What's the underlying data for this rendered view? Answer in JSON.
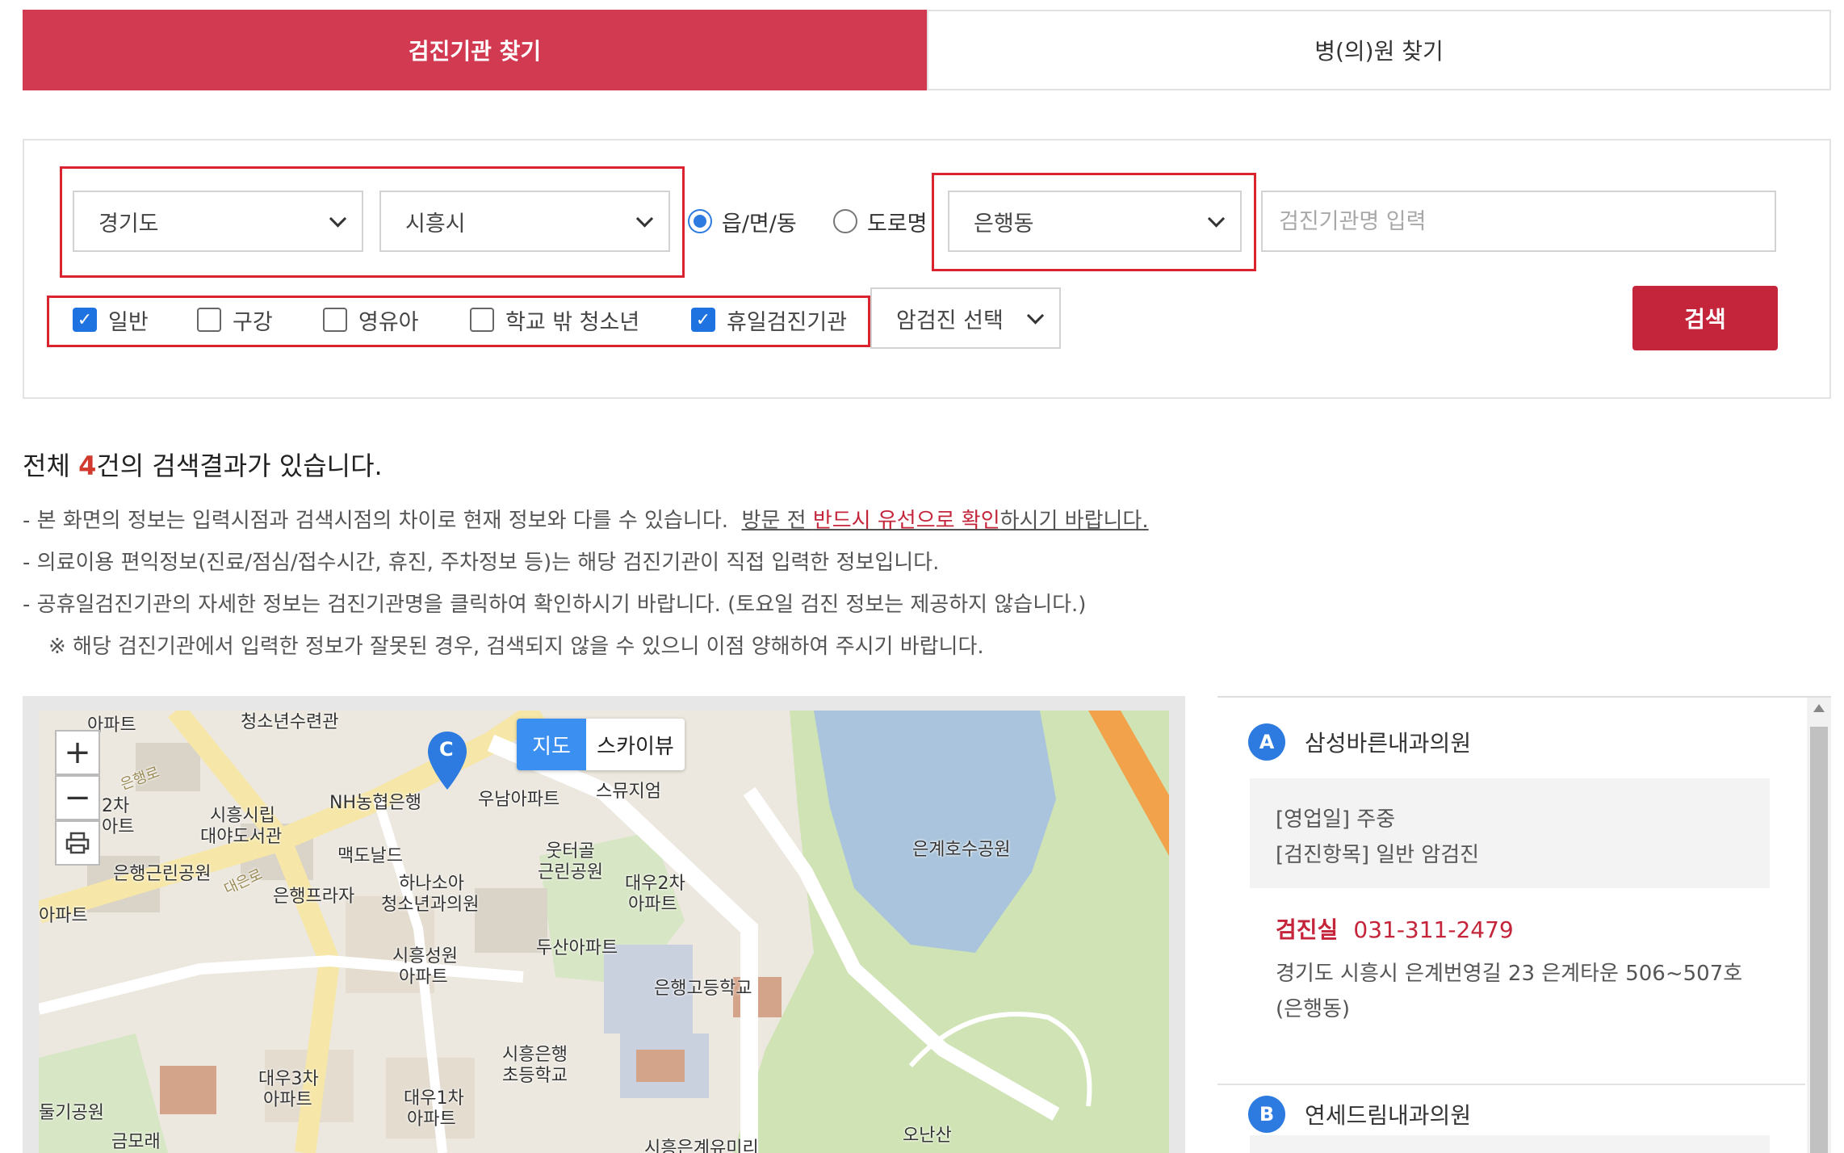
{
  "tabs": {
    "active": "검진기관 찾기",
    "inactive": "병(의)원 찾기"
  },
  "search": {
    "province": "경기도",
    "city": "시흥시",
    "radio_eup": "읍/면/동",
    "radio_road": "도로명",
    "dong": "은행동",
    "name_placeholder": "검진기관명 입력",
    "checkboxes": [
      {
        "label": "일반",
        "checked": true
      },
      {
        "label": "구강",
        "checked": false
      },
      {
        "label": "영유아",
        "checked": false
      },
      {
        "label": "학교 밖 청소년",
        "checked": false
      },
      {
        "label": "휴일검진기관",
        "checked": true
      }
    ],
    "cancer_select": "암검진 선택",
    "search_button": "검색"
  },
  "results": {
    "prefix": "전체 ",
    "count": "4",
    "suffix": "건의 검색결과가 있습니다.",
    "notes": {
      "n1_a": "- 본 화면의 정보는 입력시점과 검색시점의 차이로 현재 정보와 다를 수 있습니다.  ",
      "n1_b": "방문 전 ",
      "n1_c": "반드시 유선으로 확인",
      "n1_d": "하시기 바랍니다.",
      "n2": "- 의료이용 편익정보(진료/점심/접수시간, 휴진, 주차정보 등)는 해당 검진기관이 직접 입력한 정보입니다.",
      "n3": "- 공휴일검진기관의 자세한 정보는 검진기관명을 클릭하여 확인하시기 바랍니다. (토요일 검진 정보는 제공하지 않습니다.)",
      "n4": "※ 해당 검진기관에서 입력한 정보가 잘못된 경우, 검색되지 않을 수 있으니 이점 양해하여 주시기 바랍니다."
    }
  },
  "map": {
    "toggle_map": "지도",
    "toggle_sky": "스카이뷰",
    "zoom_in": "+",
    "zoom_out": "−",
    "marker_c": "C",
    "labels": {
      "l1": "아파트",
      "l2": "청소년수련관",
      "l3": "NH농협은행",
      "l4": "우남아파트",
      "l5": "스뮤지엄",
      "l6": "시흥시립",
      "l6b": "대야도서관",
      "l7": "2차",
      "l7b": "아트",
      "l8": "맥도날드",
      "l9": "은행근린공원",
      "l10": "하나소아",
      "l10b": "청소년과의원",
      "l11": "은행프라자",
      "l12": "웃터골",
      "l12b": "근린공원",
      "l13": "대우2차",
      "l13b": "아파트",
      "l14": "은계호수공원",
      "l15": "아파트",
      "l16": "시흥성원",
      "l16b": "아파트",
      "l17": "두산아파트",
      "l18": "은행고등학교",
      "l19": "시흥은행",
      "l19b": "초등학교",
      "l20": "대우3차",
      "l20b": "아파트",
      "l21": "대우1차",
      "l21b": "아파트",
      "l22": "둘기공원",
      "l23": "금모래",
      "l24": "오난산",
      "l25": "시흥은계유미리",
      "road1": "은행로",
      "road2": "대은로"
    }
  },
  "clinics": [
    {
      "badge": "A",
      "name": "삼성바른내과의원",
      "days": "[영업일] 주중",
      "items": "[검진항목] 일반 암검진",
      "phone_label": "검진실",
      "phone": "031-311-2479",
      "address1": "경기도 시흥시 은계번영길 23 은계타운 506~507호",
      "address2": "(은행동)"
    },
    {
      "badge": "B",
      "name": "연세드림내과의원"
    }
  ],
  "colors": {
    "accent": "#d23a52",
    "button": "#c4253a",
    "badge": "#2d7be0",
    "check": "#1e73e0"
  }
}
